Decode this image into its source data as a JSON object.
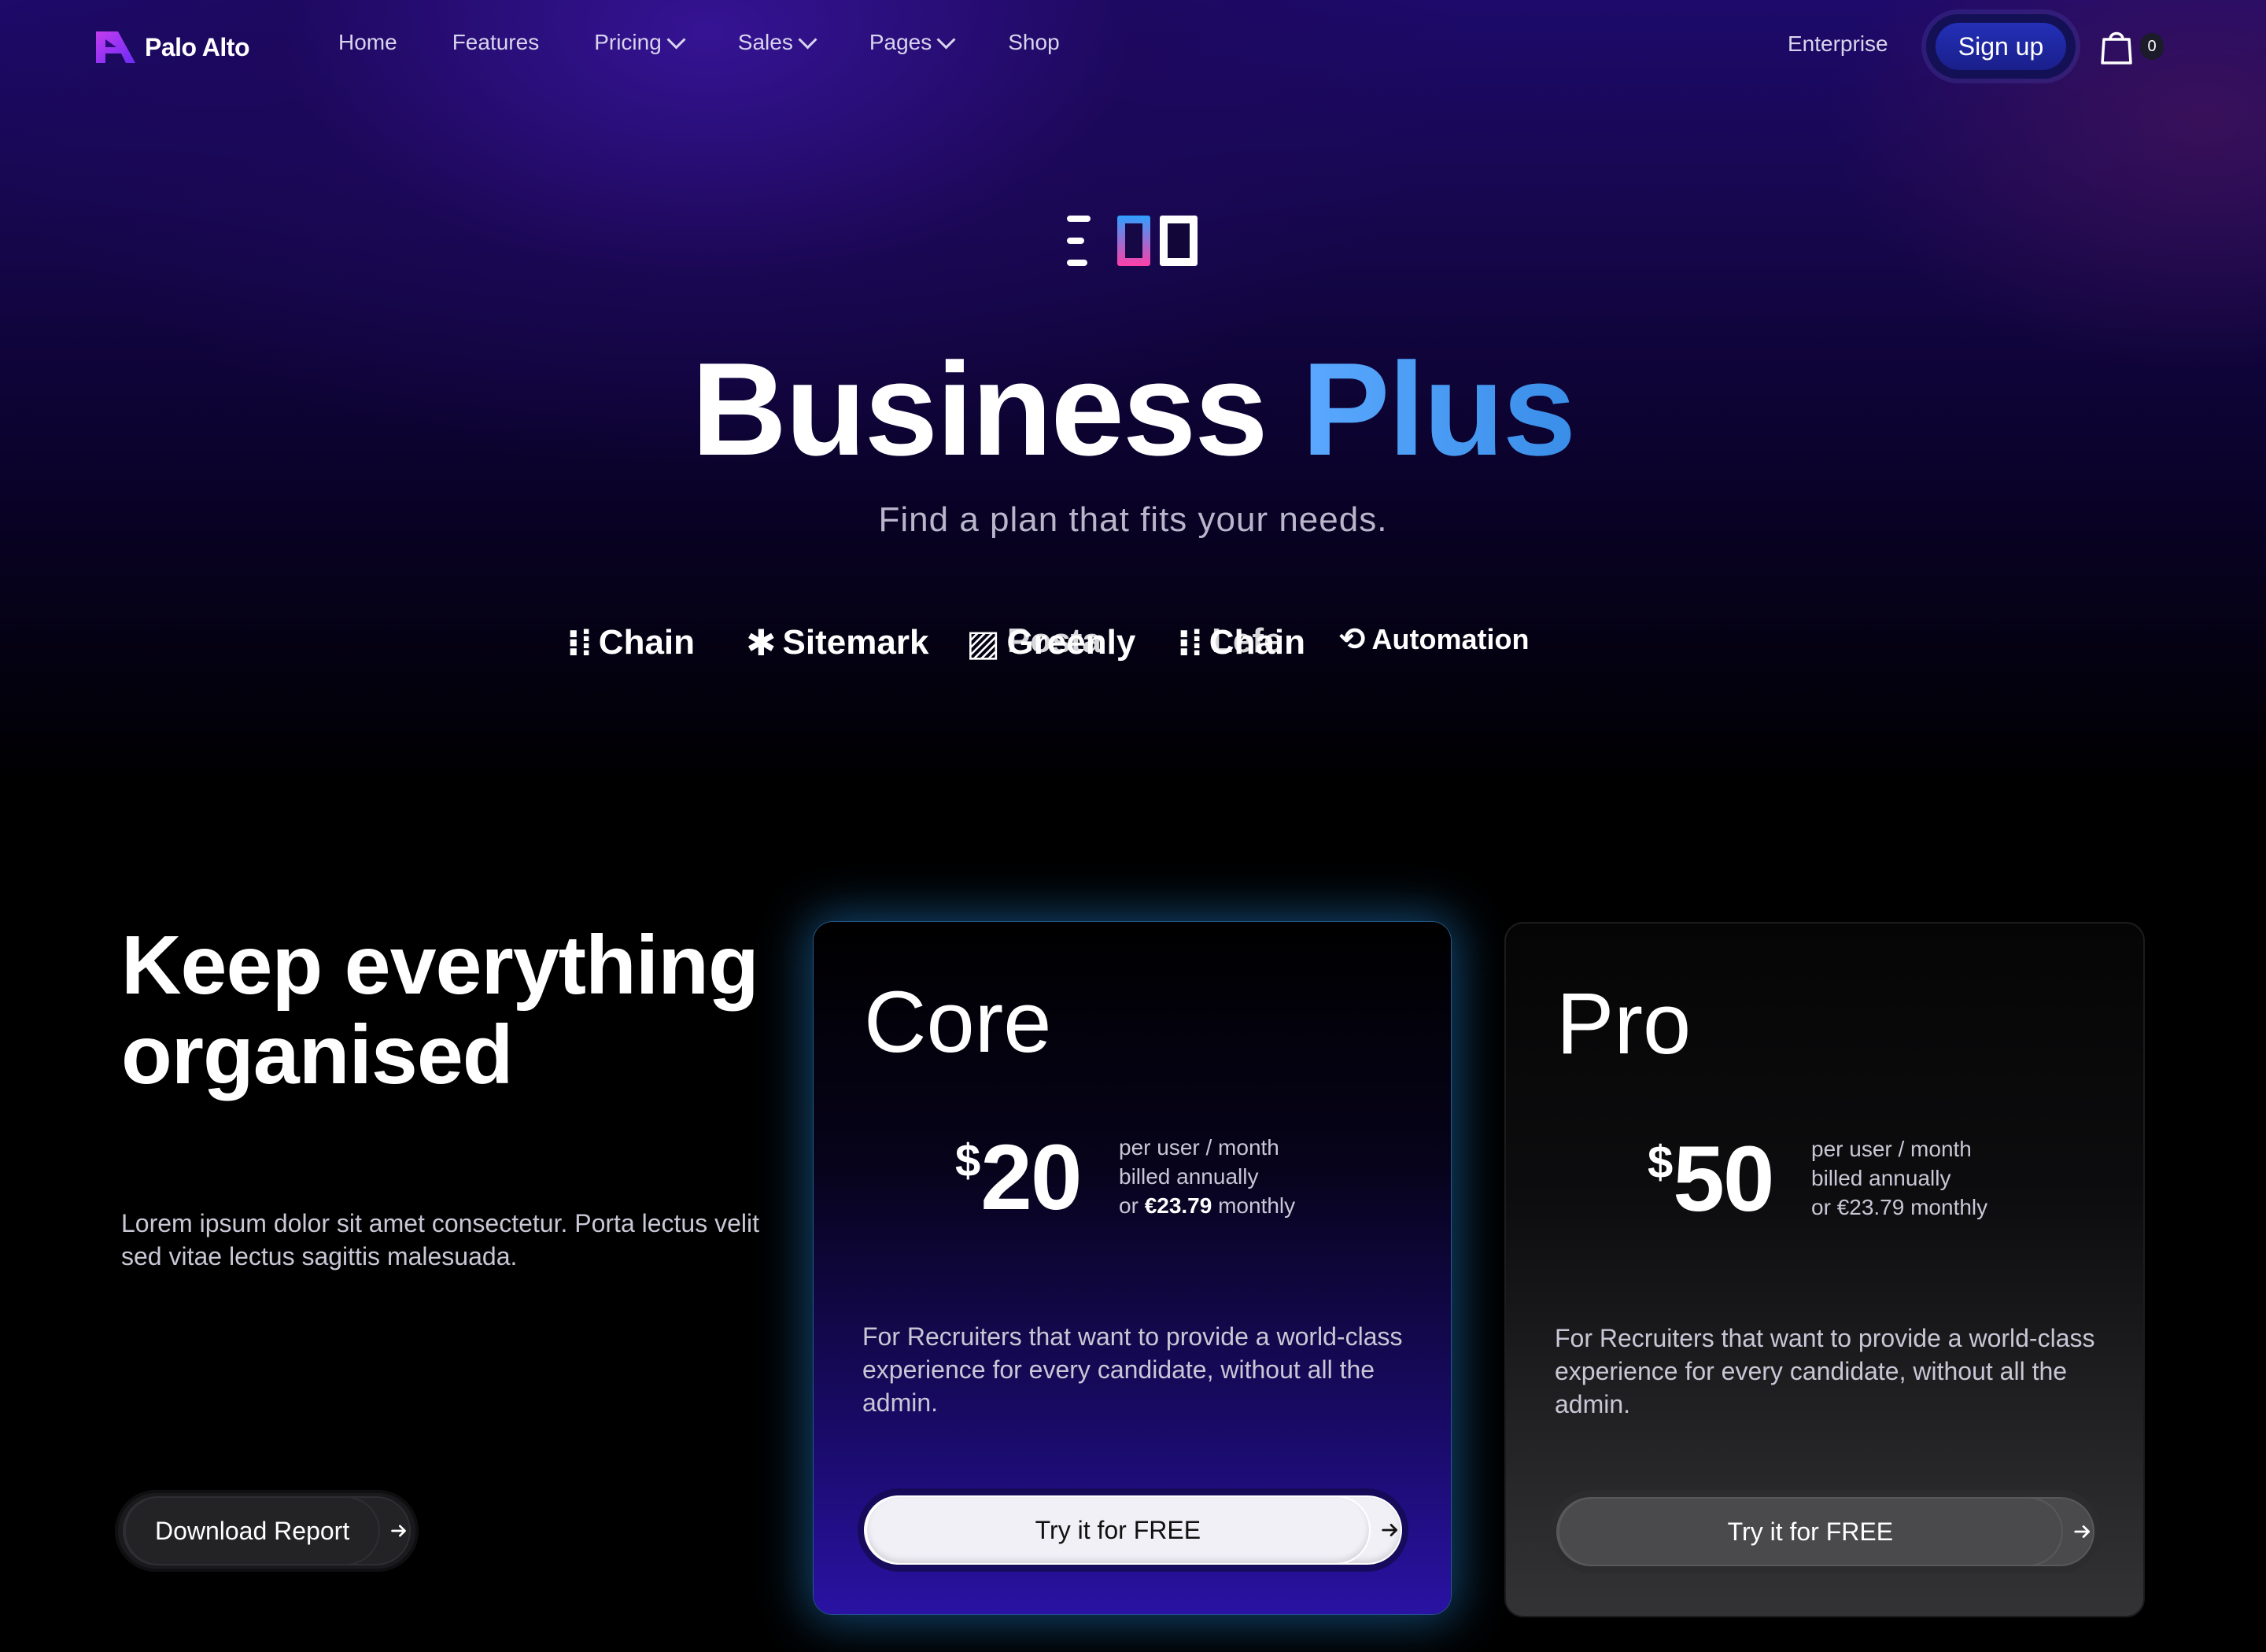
{
  "nav": {
    "brand": "Palo Alto",
    "links": [
      {
        "label": "Home",
        "dropdown": false
      },
      {
        "label": "Features",
        "dropdown": false
      },
      {
        "label": "Pricing",
        "dropdown": true
      },
      {
        "label": "Sales",
        "dropdown": true
      },
      {
        "label": "Pages",
        "dropdown": true
      },
      {
        "label": "Shop",
        "dropdown": false
      }
    ],
    "enterprise": "Enterprise",
    "signup": "Sign up",
    "cart_count": "0",
    "cart_icon": "shopping-bag-icon"
  },
  "hero": {
    "icon": "grid-layout-icon",
    "title_main": "Business",
    "title_accent": "Plus",
    "subtitle": "Find a plan that fits your needs.",
    "logos": [
      "Chain",
      "Sitemark",
      "Greenly",
      "Posta",
      "Chain",
      "Lefe",
      "Automation"
    ]
  },
  "section": {
    "title": "Keep everything organised",
    "description": "Lorem ipsum dolor sit amet consectetur. Porta lectus velit sed vitae lectus sagittis malesuada.",
    "download_label": "Download Report"
  },
  "plans": [
    {
      "name": "Core",
      "currency": "$",
      "price": "20",
      "per": "per user / month",
      "billed": "billed annually",
      "monthly_prefix": "or",
      "monthly_price": "€23.79",
      "monthly_suffix": "monthly",
      "description": "For Recruiters that want to provide a world-class experience for every candidate, without all the admin.",
      "cta": "Try it for FREE"
    },
    {
      "name": "Pro",
      "currency": "$",
      "price": "50",
      "per": "per user / month",
      "billed": "billed annually",
      "monthly_prefix": "or",
      "monthly_price": "€23.79",
      "monthly_suffix": "monthly",
      "description": "For Recruiters that want to provide a world-class experience for every candidate, without all the admin.",
      "cta": "Try it for FREE"
    }
  ],
  "colors": {
    "accent_blue": "#5aa8ff",
    "signup_bg": "#1a1f8a",
    "core_card_bottom": "#2a12a3",
    "core_glow": "#2896f0"
  }
}
